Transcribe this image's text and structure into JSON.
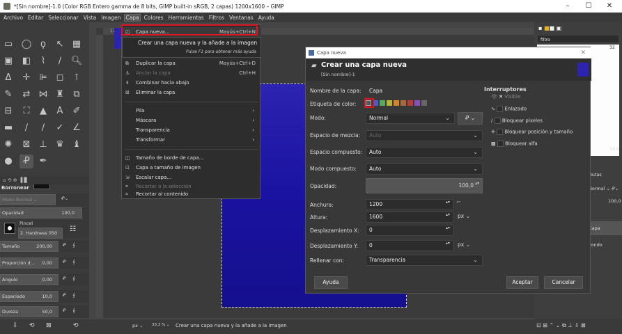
{
  "window": {
    "title": "*[Sin nombre]-1.0 (Color RGB Entero gamma de 8 bits, GIMP built-in sRGB, 2 capas) 1200x1600 – GIMP",
    "min": "–",
    "max": "☐",
    "close": "✕"
  },
  "menubar": [
    "Archivo",
    "Editar",
    "Seleccionar",
    "Vista",
    "Imagen",
    "Capa",
    "Colores",
    "Herramientas",
    "Filtros",
    "Ventanas",
    "Ayuda"
  ],
  "capa_menu": {
    "items": [
      {
        "label": "Capa nueva...",
        "accel": "Mayús+Ctrl+N",
        "icon": "new-layer-icon"
      },
      {
        "label": "Duplicar la capa",
        "accel": "Mayús+Ctrl+D",
        "icon": "duplicate-icon"
      },
      {
        "label": "Anclar la capa",
        "accel": "Ctrl+H",
        "icon": "anchor-icon"
      },
      {
        "label": "Combinar hacia abajo",
        "accel": "",
        "icon": "merge-down-icon"
      },
      {
        "label": "Eliminar la capa",
        "accel": "",
        "icon": "delete-icon"
      },
      {
        "label": "Pila",
        "accel": "",
        "icon": ""
      },
      {
        "label": "Máscara",
        "accel": "",
        "icon": ""
      },
      {
        "label": "Transparencia",
        "accel": "",
        "icon": ""
      },
      {
        "label": "Transformar",
        "accel": "",
        "icon": ""
      },
      {
        "label": "Tamaño de borde de capa...",
        "accel": "",
        "icon": "boundary-icon"
      },
      {
        "label": "Capa a tamaño de imagen",
        "accel": "",
        "icon": "layer-to-image-icon"
      },
      {
        "label": "Escalar capa...",
        "accel": "",
        "icon": "scale-icon"
      },
      {
        "label": "Recortar a la selección",
        "accel": "",
        "icon": "crop-icon"
      },
      {
        "label": "Recortar al contenido",
        "accel": "",
        "icon": "crop-content-icon"
      }
    ]
  },
  "tooltip": {
    "text": "Crear una capa nueva y la añade a la imagen",
    "hint": "Pulse F1 para obtener más ayuda"
  },
  "dialog": {
    "window_title": "Capa nueva",
    "header_title": "Crear una capa nueva",
    "header_sub": "[Sin nombre]-1",
    "name_label": "Nombre de la capa:",
    "name_value": "Capa",
    "color_label": "Etiqueta de color:",
    "tag_colors": [
      "#555555",
      "#4a5ccf",
      "#5aa85a",
      "#b8b23a",
      "#d0862c",
      "#a66a3e",
      "#b83c3c",
      "#8a4fb8",
      "#666666"
    ],
    "modo_label": "Modo:",
    "modo_value": "Normal",
    "mezcla_label": "Espacio de mezcla:",
    "mezcla_value": "Auto",
    "compuesto_label": "Espacio compuesto:",
    "compuesto_value": "Auto",
    "modo_comp_label": "Modo compuesto:",
    "modo_comp_value": "Auto",
    "opacidad_label": "Opacidad:",
    "opacidad_value": "100,0",
    "anchura_label": "Anchura:",
    "anchura_value": "1200",
    "altura_label": "Altura:",
    "altura_value": "1600",
    "unit": "px",
    "despx_label": "Desplazamiento X:",
    "despx_value": "0",
    "despy_label": "Desplazamiento Y:",
    "despy_value": "0",
    "rellenar_label": "Rellenar con:",
    "rellenar_value": "Transparencia",
    "interruptores_title": "Interruptores",
    "switches": [
      "Visible",
      "Enlazado",
      "Bloquear píxeles",
      "Bloquear posición y tamaño",
      "Bloquear alfa"
    ],
    "btn_help": "Ayuda",
    "btn_ok": "Aceptar",
    "btn_cancel": "Cancelar"
  },
  "tool_options": {
    "title": "Borronear",
    "mode_label": "Modo",
    "mode_value": "Normal",
    "rows": [
      {
        "label": "Opacidad",
        "value": "100,0"
      },
      {
        "label": "Pincel",
        "value": "2. Hardness 050"
      },
      {
        "label": "Tamaño",
        "value": "200,00"
      },
      {
        "label": "Proporción d...",
        "value": "0,00"
      },
      {
        "label": "Ángulo",
        "value": "0,00"
      },
      {
        "label": "Espaciado",
        "value": "10,0"
      },
      {
        "label": "Dureza",
        "value": "50,0"
      }
    ]
  },
  "status": {
    "unit": "px",
    "zoom": "33,3 %",
    "text": "Crear una capa nueva y la añade a la imagen"
  },
  "ruler": {
    "val1": "1750"
  },
  "right_dock": {
    "filter_placeholder": "filtro",
    "size": "32",
    "rutas": "Rutas",
    "mode": "Normal",
    "opacity": "100,0",
    "brush_size": "10,0",
    "layer1": "Capa",
    "layer2": "Fondo"
  }
}
